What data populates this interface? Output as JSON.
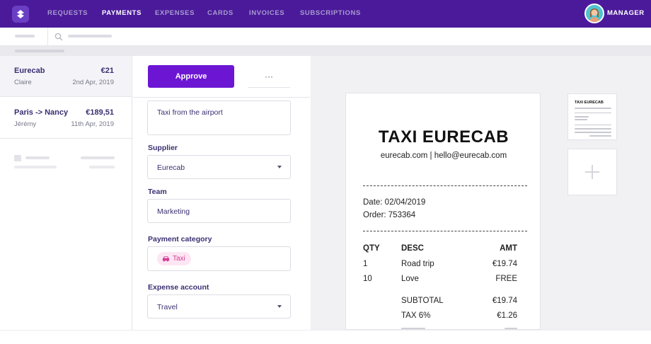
{
  "nav": {
    "items": [
      {
        "label": "REQUESTS"
      },
      {
        "label": "PAYMENTS"
      },
      {
        "label": "EXPENSES"
      },
      {
        "label": "CARDS"
      },
      {
        "label": "INVOICES"
      },
      {
        "label": "SUBSCRIPTIONS"
      }
    ],
    "active": "PAYMENTS",
    "user_label": "MANAGER"
  },
  "colors": {
    "nav_bg": "#4b1a9a",
    "accent": "#6c16d4",
    "chip_bg": "#fde6f3",
    "chip_text": "#d43c97"
  },
  "payments": [
    {
      "title": "Eurecab",
      "amount": "€21",
      "person": "Claire",
      "date": "2nd Apr, 2019"
    },
    {
      "title": "Paris -> Nancy",
      "amount": "€189,51",
      "person": "Jérémy",
      "date": "11th Apr, 2019"
    }
  ],
  "form": {
    "approve_label": "Approve",
    "more_label": "···",
    "description": "Taxi from the airport",
    "supplier_label": "Supplier",
    "supplier_value": "Eurecab",
    "team_label": "Team",
    "team_value": "Marketing",
    "category_label": "Payment category",
    "category_value": "Taxi",
    "category_icon": "car-icon",
    "account_label": "Expense account",
    "account_value": "Travel"
  },
  "receipt": {
    "title": "TAXI EURECAB",
    "contact": "eurecab.com | hello@eurecab.com",
    "date_line": "Date: 02/04/2019",
    "order_line": "Order: 753364",
    "columns": [
      "QTY",
      "DESC",
      "AMT"
    ],
    "rows": [
      {
        "qty": "1",
        "desc": "Road trip",
        "amt": "€19.74"
      },
      {
        "qty": "10",
        "desc": "Love",
        "amt": "FREE"
      }
    ],
    "subtotal_label": "SUBTOTAL",
    "subtotal_value": "€19.74",
    "tax_label": "TAX 6%",
    "tax_value": "€1.26"
  },
  "thumbnail": {
    "title": "TAXI EURECAB"
  }
}
